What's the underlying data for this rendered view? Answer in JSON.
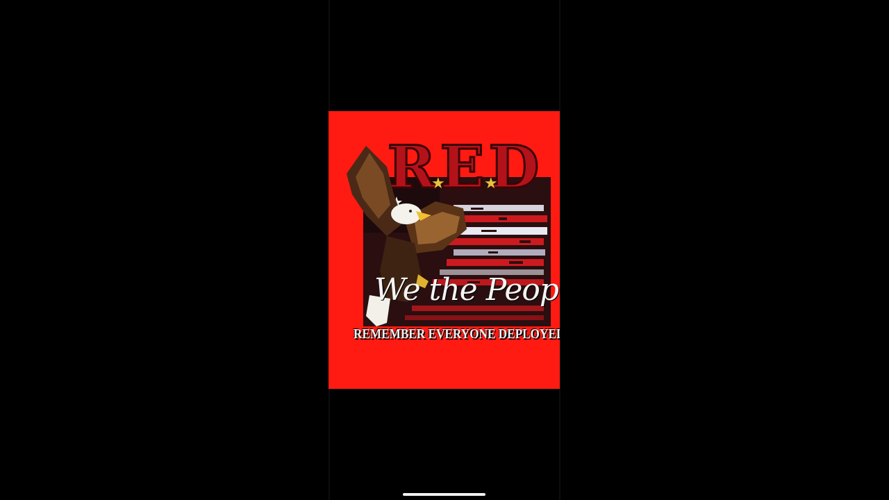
{
  "media_viewer": {
    "background_color": "#000000",
    "poster": {
      "background_color": "#ff1a12",
      "headline": "RED",
      "script_text": "We the People",
      "tagline": "REMEMBER EVERYONE DEPLOYED",
      "accent_colors": {
        "headline_fill": "#b3121a",
        "flag_dark": "#2a0e10",
        "flag_stripe_white": "#e9e9f2",
        "flag_stripe_red": "#cc1b1f",
        "gold_star": "#e8c33a"
      },
      "decorations": [
        "bald-eagle-illustration",
        "distressed-american-flag",
        "gold-star-icon",
        "white-star-icon"
      ]
    },
    "home_indicator_color": "#f2f2f2"
  }
}
